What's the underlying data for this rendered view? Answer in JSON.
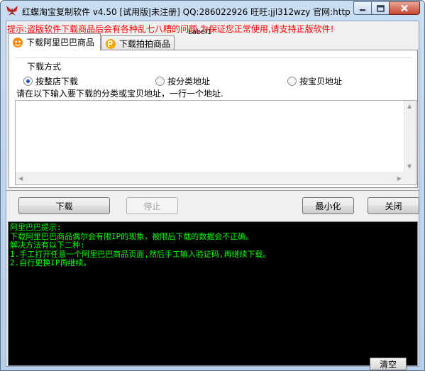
{
  "window": {
    "title": "红蝶淘宝复制软件 v4.50 [试用版|未注册] QQ:286022926 旺旺:jjl312wzy 官网:http..."
  },
  "warning": "提示:盗版软件下载商品后会有各种乱七八糟的问题,为保证您正常使用,请支持正版软件!",
  "label1": "Label1",
  "tabs": [
    {
      "label": "下载阿里巴巴商品",
      "icon": "alibaba-icon"
    },
    {
      "label": "下载拍拍商品",
      "icon": "paipai-icon"
    }
  ],
  "download_mode": {
    "group_label": "下载方式",
    "options": [
      {
        "label": "按整店下载",
        "selected": true
      },
      {
        "label": "按分类地址",
        "selected": false
      },
      {
        "label": "按宝贝地址",
        "selected": false
      }
    ]
  },
  "instruction": "请在以下输入要下载的分类或宝贝地址，一行一个地址.",
  "url_input": {
    "value": ""
  },
  "buttons": {
    "download": "下载",
    "stop": "停止",
    "minimize": "最小化",
    "close": "关闭",
    "clear": "清空"
  },
  "console_lines": [
    "阿里巴巴提示:",
    "下载阿里巴巴商品偶尔会有限IP的现象，被限后下载的数据会不正确。",
    "解决方法有以下二种:",
    "1.手工打开任意一个阿里巴巴商品页面,然后手工输入验证码,再继续下载。",
    "2.自行更换IP再继续。"
  ],
  "colors": {
    "warning": "#ff0000",
    "console_bg": "#000000",
    "console_text": "#00ff00"
  }
}
